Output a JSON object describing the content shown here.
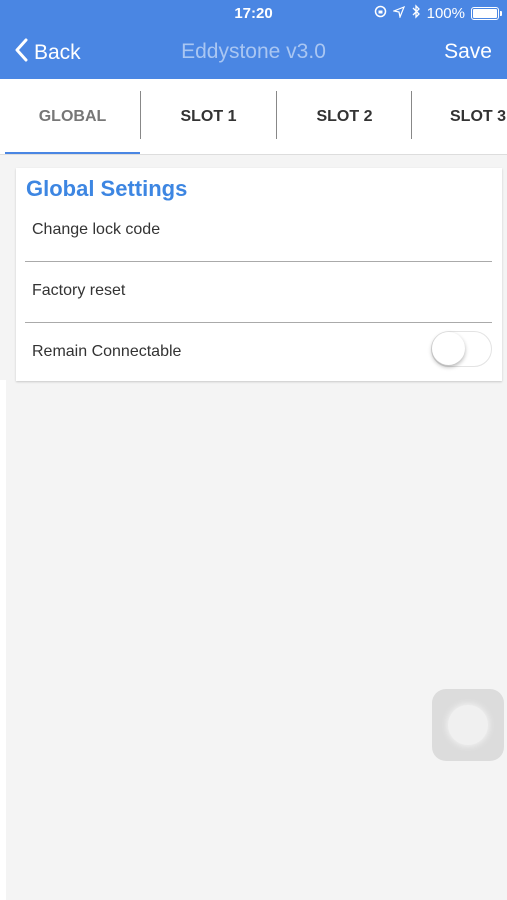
{
  "status_bar": {
    "time": "17:20",
    "battery": "100%"
  },
  "nav": {
    "back_label": "Back",
    "title": "Eddystone v3.0",
    "save_label": "Save"
  },
  "tabs": [
    {
      "label": "GLOBAL",
      "active": true
    },
    {
      "label": "SLOT 1",
      "active": false
    },
    {
      "label": "SLOT 2",
      "active": false
    },
    {
      "label": "SLOT 3",
      "active": false
    }
  ],
  "global_settings": {
    "title": "Global Settings",
    "items": [
      {
        "label": "Change lock code"
      },
      {
        "label": "Factory reset"
      },
      {
        "label": "Remain Connectable",
        "toggle_on": false
      }
    ]
  },
  "colors": {
    "brand": "#4a86e3",
    "title_text": "#3d86e2"
  }
}
